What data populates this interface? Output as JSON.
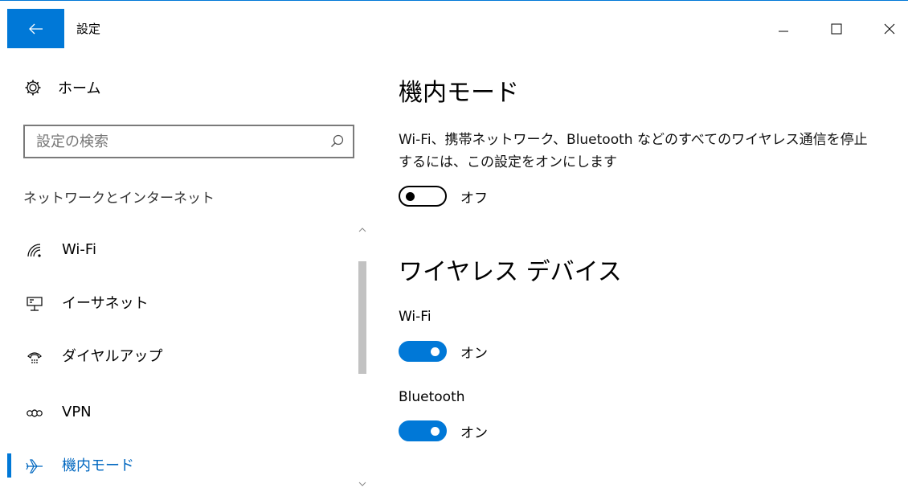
{
  "window": {
    "title": "設定",
    "back_icon": "back-arrow-icon",
    "controls": {
      "minimize_icon": "minimize-icon",
      "maximize_icon": "maximize-icon",
      "close_icon": "close-icon"
    }
  },
  "sidebar": {
    "home_label": "ホーム",
    "search_placeholder": "設定の検索",
    "section_title": "ネットワークとインターネット",
    "items": [
      {
        "label": "Wi-Fi",
        "icon": "wifi-icon",
        "active": false
      },
      {
        "label": "イーサネット",
        "icon": "ethernet-icon",
        "active": false
      },
      {
        "label": "ダイヤルアップ",
        "icon": "dialup-icon",
        "active": false
      },
      {
        "label": "VPN",
        "icon": "vpn-icon",
        "active": false
      },
      {
        "label": "機内モード",
        "icon": "airplane-icon",
        "active": true
      }
    ]
  },
  "main": {
    "airplane_title": "機内モード",
    "airplane_description": "Wi-Fi、携帯ネットワーク、Bluetooth などのすべてのワイヤレス通信を停止するには、この設定をオンにします",
    "airplane_toggle": {
      "state": "off",
      "label": "オフ"
    },
    "wireless_title": "ワイヤレス デバイス",
    "wifi": {
      "label": "Wi-Fi",
      "state": "on",
      "toggle_label": "オン"
    },
    "bluetooth": {
      "label": "Bluetooth",
      "state": "on",
      "toggle_label": "オン"
    }
  },
  "colors": {
    "accent": "#0078d7",
    "scroll_thumb": "#c2c2c2"
  }
}
